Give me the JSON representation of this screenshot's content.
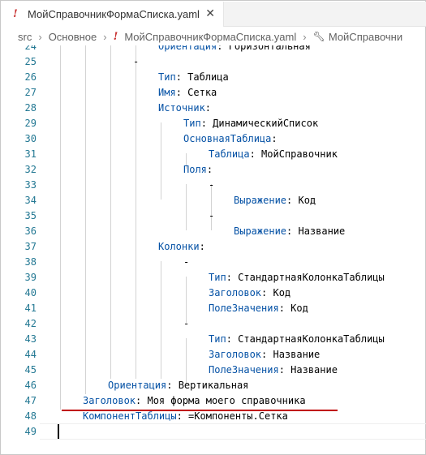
{
  "tab": {
    "filename": "МойСправочникФормаСписка.yaml",
    "close_glyph": "✕"
  },
  "breadcrumb": {
    "items": [
      "src",
      "Основное",
      "МойСправочникФормаСписка.yaml",
      "МойСправочни"
    ]
  },
  "editor": {
    "lines": [
      {
        "n": "24",
        "indent": 4,
        "key": "Ориентация",
        "sep": ": ",
        "value": "Горизонтальная"
      },
      {
        "n": "25",
        "indent": 3,
        "key": "",
        "sep": "",
        "value": "-"
      },
      {
        "n": "26",
        "indent": 4,
        "key": "Тип",
        "sep": ": ",
        "value": "Таблица"
      },
      {
        "n": "27",
        "indent": 4,
        "key": "Имя",
        "sep": ": ",
        "value": "Сетка"
      },
      {
        "n": "28",
        "indent": 4,
        "key": "Источник",
        "sep": ":",
        "value": ""
      },
      {
        "n": "29",
        "indent": 5,
        "key": "Тип",
        "sep": ": ",
        "value": "ДинамическийСписок"
      },
      {
        "n": "30",
        "indent": 5,
        "key": "ОсновнаяТаблица",
        "sep": ":",
        "value": ""
      },
      {
        "n": "31",
        "indent": 6,
        "key": "Таблица",
        "sep": ": ",
        "value": "МойСправочник"
      },
      {
        "n": "32",
        "indent": 5,
        "key": "Поля",
        "sep": ":",
        "value": ""
      },
      {
        "n": "33",
        "indent": 6,
        "key": "",
        "sep": "",
        "value": "-"
      },
      {
        "n": "34",
        "indent": 7,
        "key": "Выражение",
        "sep": ": ",
        "value": "Код"
      },
      {
        "n": "35",
        "indent": 6,
        "key": "",
        "sep": "",
        "value": "-"
      },
      {
        "n": "36",
        "indent": 7,
        "key": "Выражение",
        "sep": ": ",
        "value": "Название"
      },
      {
        "n": "37",
        "indent": 4,
        "key": "Колонки",
        "sep": ":",
        "value": ""
      },
      {
        "n": "38",
        "indent": 5,
        "key": "",
        "sep": "",
        "value": "-"
      },
      {
        "n": "39",
        "indent": 6,
        "key": "Тип",
        "sep": ": ",
        "value": "СтандартнаяКолонкаТаблицы"
      },
      {
        "n": "40",
        "indent": 6,
        "key": "Заголовок",
        "sep": ": ",
        "value": "Код"
      },
      {
        "n": "41",
        "indent": 6,
        "key": "ПолеЗначения",
        "sep": ": ",
        "value": "Код"
      },
      {
        "n": "42",
        "indent": 5,
        "key": "",
        "sep": "",
        "value": "-"
      },
      {
        "n": "43",
        "indent": 6,
        "key": "Тип",
        "sep": ": ",
        "value": "СтандартнаяКолонкаТаблицы"
      },
      {
        "n": "44",
        "indent": 6,
        "key": "Заголовок",
        "sep": ": ",
        "value": "Название"
      },
      {
        "n": "45",
        "indent": 6,
        "key": "ПолеЗначения",
        "sep": ": ",
        "value": "Название"
      },
      {
        "n": "46",
        "indent": 2,
        "key": "Ориентация",
        "sep": ": ",
        "value": "Вертикальная"
      },
      {
        "n": "47",
        "indent": 1,
        "key": "Заголовок",
        "sep": ": ",
        "value": "Моя форма моего справочника"
      },
      {
        "n": "48",
        "indent": 1,
        "key": "КомпонентТаблицы",
        "sep": ": ",
        "value": "=Компоненты.Сетка"
      },
      {
        "n": "49",
        "indent": 0,
        "key": "",
        "sep": "",
        "value": ""
      }
    ]
  },
  "colors": {
    "key": "#0451a5",
    "line_number": "#237893",
    "underline": "#c00000",
    "yaml_icon": "#c72e2e"
  },
  "icons": {
    "tab_icon": "yaml-exclamation-icon",
    "breadcrumb_tail_icon": "wrench-icon",
    "separator_icon": "chevron-right-icon"
  }
}
